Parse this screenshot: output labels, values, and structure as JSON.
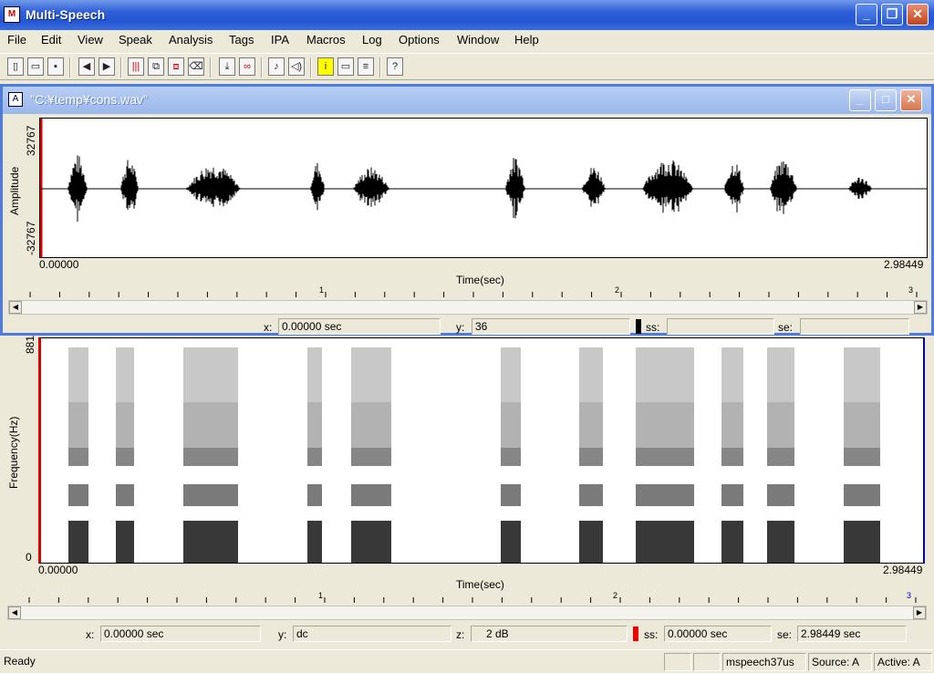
{
  "app": {
    "title": "Multi-Speech"
  },
  "menu": [
    "File",
    "Edit",
    "View",
    "Speak",
    "Analysis",
    "Tags",
    "IPA",
    "Macros",
    "Log",
    "Options",
    "Window",
    "Help"
  ],
  "child": {
    "title": "\"C:¥temp¥cons.wav\""
  },
  "wave": {
    "ylabel": "Amplitude",
    "ymax": "32767",
    "ymin": "-32767",
    "xstart": "0.00000",
    "xend": "2.98449",
    "xlabel": "Time(sec)",
    "ruler": [
      "1",
      "2",
      "3"
    ],
    "status": {
      "x_label": "x:",
      "x_val": "0.00000 sec",
      "y_label": "y:",
      "y_val": "36",
      "ss_label": "ss:",
      "ss_val": "",
      "se_label": "se:",
      "se_val": ""
    }
  },
  "spec": {
    "ylabel": "Frequency(Hz)",
    "ymax": "881",
    "ymin": "0",
    "xstart": "0.00000",
    "xend": "2.98449",
    "xlabel": "Time(sec)",
    "ruler": [
      "1",
      "2",
      "3"
    ],
    "status": {
      "x_label": "x:",
      "x_val": "0.00000 sec",
      "y_label": "y:",
      "y_val": "dc",
      "z_label": "z:",
      "z_val": "2 dB",
      "ss_label": "ss:",
      "ss_val": "0.00000 sec",
      "se_label": "se:",
      "se_val": "2.98449 sec"
    }
  },
  "statusbar": {
    "ready": "Ready",
    "program": "mspeech37us",
    "source": "Source: A",
    "active": "Active: A"
  }
}
